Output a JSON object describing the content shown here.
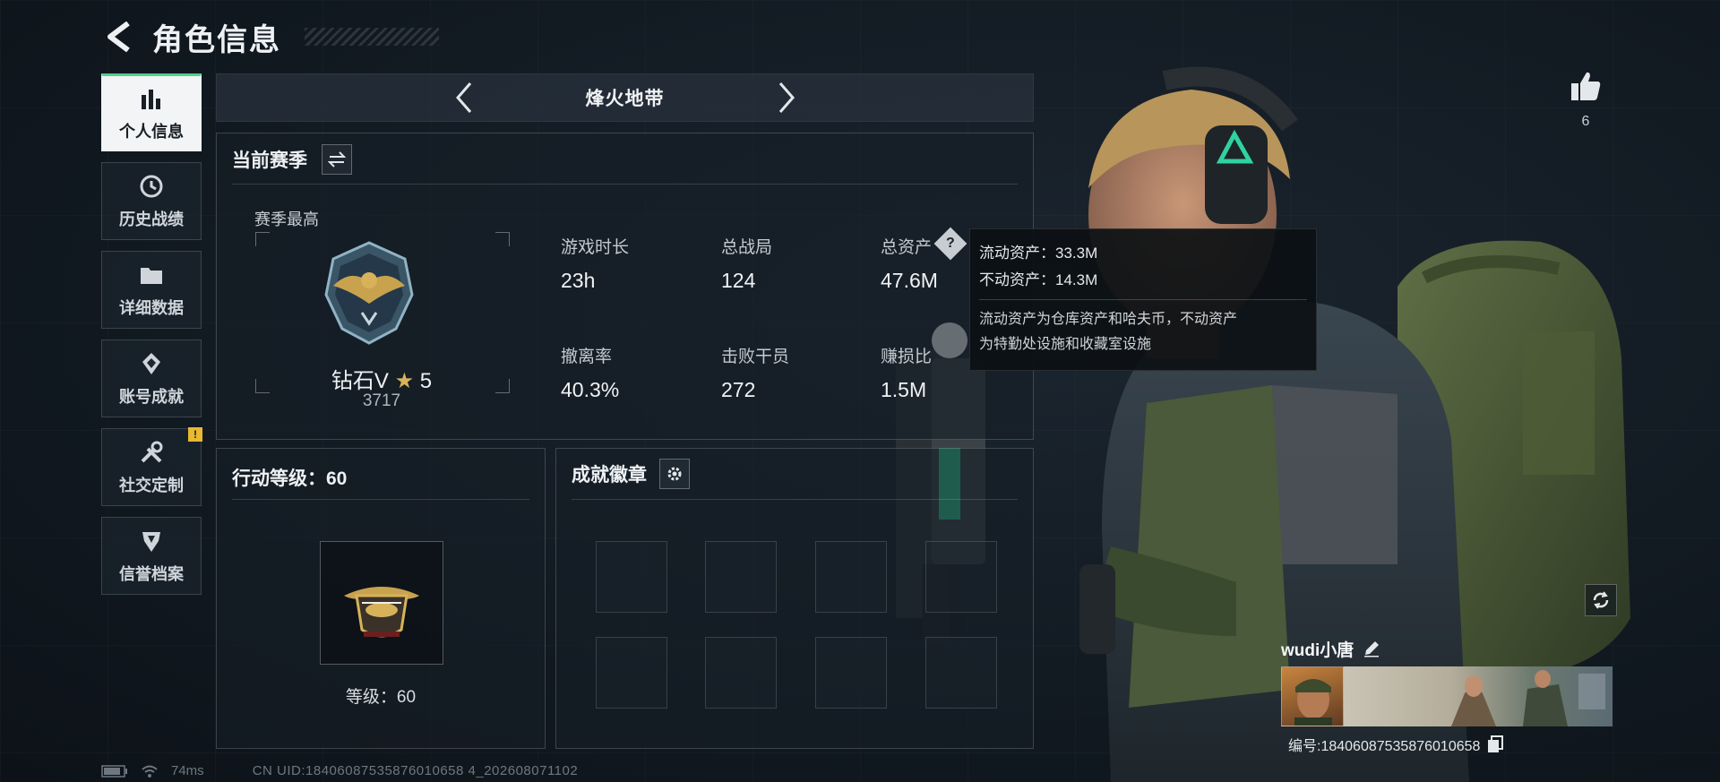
{
  "header": {
    "title": "角色信息"
  },
  "sidebar": {
    "items": [
      {
        "label": "个人信息",
        "icon": "bar-chart-icon",
        "active": true
      },
      {
        "label": "历史战绩",
        "icon": "history-clock-icon"
      },
      {
        "label": "详细数据",
        "icon": "folder-icon"
      },
      {
        "label": "账号成就",
        "icon": "achievement-icon"
      },
      {
        "label": "社交定制",
        "icon": "wrench-icon",
        "badge": "!"
      },
      {
        "label": "信誉档案",
        "icon": "credit-shield-icon"
      }
    ]
  },
  "mode_nav": {
    "title": "烽火地带"
  },
  "season": {
    "title": "当前赛季",
    "best_label": "赛季最高",
    "rank_name": "钻石V",
    "rank_stars": "5",
    "rank_score": "3717",
    "stats": [
      {
        "label": "游戏时长",
        "value": "23h"
      },
      {
        "label": "总战局",
        "value": "124"
      },
      {
        "label": "总资产",
        "value": "47.6M"
      },
      {
        "label": "撤离率",
        "value": "40.3%"
      },
      {
        "label": "击败干员",
        "value": "272"
      },
      {
        "label": "赚损比",
        "value": "1.5M"
      }
    ]
  },
  "tooltip": {
    "line1": "流动资产：33.3M",
    "line2": "不动资产：14.3M",
    "desc1": "流动资产为仓库资产和哈夫币，不动资产",
    "desc2": "为特勤处设施和收藏室设施"
  },
  "level": {
    "title": "行动等级：60",
    "level_text": "等级：60"
  },
  "badges": {
    "title": "成就徽章"
  },
  "like": {
    "count": "6"
  },
  "player": {
    "name": "wudi小唐",
    "id": "编号:18406087535876010658"
  },
  "status": {
    "ping": "74ms",
    "uid": "CN UID:18406087535876010658 4_202608071102"
  },
  "colors": {
    "accent_green": "#4fd18b",
    "warning_yellow": "#e8b931"
  }
}
